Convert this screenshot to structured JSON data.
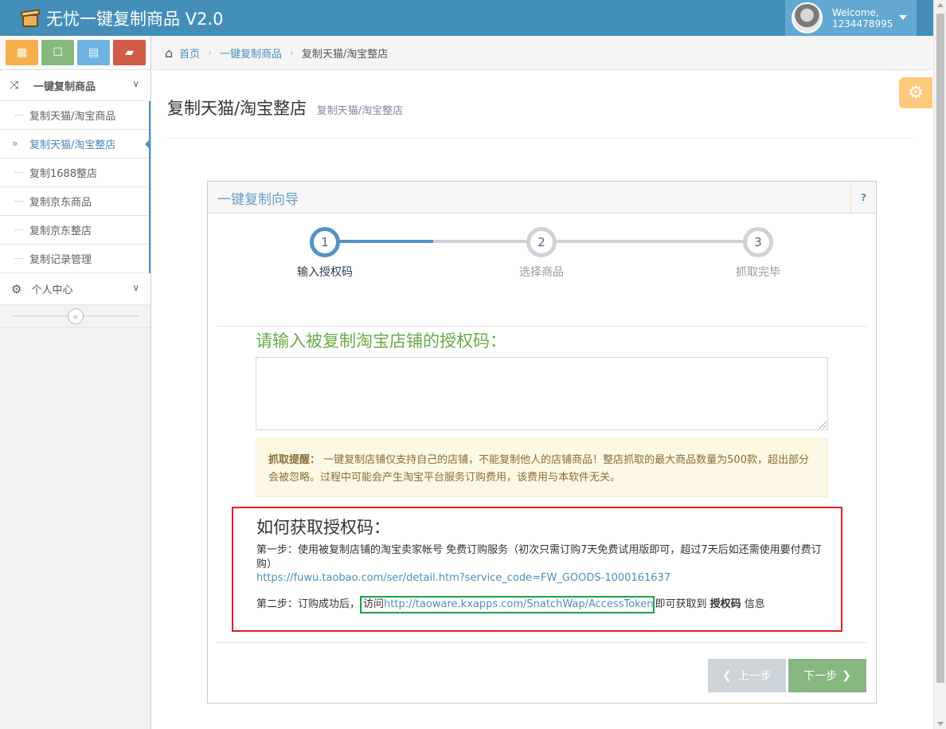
{
  "app": {
    "title": "无忧一键复制商品 V2.0",
    "welcome": "Welcome,",
    "username": "1234478995"
  },
  "shortcuts": [
    {
      "icon": "calendar-icon",
      "color": "#f5b04d"
    },
    {
      "icon": "square-icon",
      "color": "#87b87f"
    },
    {
      "icon": "grid-icon",
      "color": "#6fb3e0"
    },
    {
      "icon": "book-icon",
      "color": "#d15b47"
    }
  ],
  "sidebar": {
    "group1": "一键复制商品",
    "items": [
      {
        "label": "复制天猫/淘宝商品"
      },
      {
        "label": "复制天猫/淘宝整店"
      },
      {
        "label": "复制1688整店"
      },
      {
        "label": "复制京东商品"
      },
      {
        "label": "复制京东整店"
      },
      {
        "label": "复制记录管理"
      }
    ],
    "group2": "个人中心"
  },
  "breadcrumb": {
    "home": "首页",
    "section": "一键复制商品",
    "current": "复制天猫/淘宝整店"
  },
  "page": {
    "title": "复制天猫/淘宝整店",
    "subtitle": "复制天猫/淘宝整店"
  },
  "wizard": {
    "title": "一键复制向导",
    "help": "?",
    "steps": [
      {
        "num": "1",
        "label": "输入授权码"
      },
      {
        "num": "2",
        "label": "选择商品"
      },
      {
        "num": "3",
        "label": "抓取完毕"
      }
    ],
    "prompt": "请输入被复制淘宝店铺的授权码：",
    "code_value": "",
    "alert_bold": "抓取提醒：",
    "alert_text": "一键复制店铺仅支持自己的店铺，不能复制他人的店铺商品！整店抓取的最大商品数量为500款，超出部分会被忽略。过程中可能会产生淘宝平台服务订购费用，该费用与本软件无关。",
    "howto_title": "如何获取授权码：",
    "step1_text": "第一步：使用被复制店铺的淘宝卖家帐号 免费订购服务（初次只需订购7天免费试用版即可，超过7天后如还需使用要付费订购）",
    "step1_link": "https://fuwu.taobao.com/ser/detail.htm?service_code=FW_GOODS-1000161637",
    "step2_prefix": "第二步：订购成功后，",
    "step2_visit": "访问",
    "step2_link": "http://taoware.kxapps.com/SnatchWap/AccessToken",
    "step2_mid": "即可获取到 ",
    "step2_bold": "授权码",
    "step2_suffix": " 信息",
    "prev_label": "上一步",
    "next_label": "下一步"
  }
}
